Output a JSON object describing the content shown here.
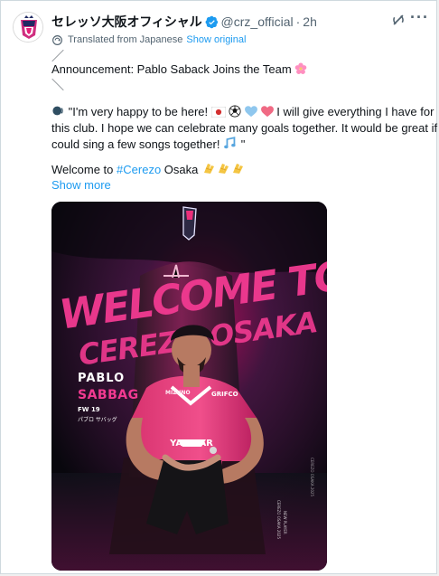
{
  "tweet": {
    "display_name": "セレッソ大阪オフィシャル",
    "handle": "@crz_official",
    "separator": "·",
    "time": "2h",
    "translated_text": "Translated from Japanese",
    "show_original": "Show original",
    "slash_top": "／",
    "announcement": "Announcement: Pablo Saback Joins the Team",
    "slash_bottom": "＼",
    "quote_line_1": "\"I'm very happy to be here!",
    "quote_line_1b": "I will give everything I have for",
    "quote_line_2": "this club. I hope we can celebrate many goals together. It would be great if we",
    "quote_line_3": "could sing a few songs together!",
    "quote_close": "\"",
    "welcome_prefix": "Welcome to",
    "hashtag": "#Cerezo",
    "welcome_suffix": "Osaka",
    "show_more": "Show more"
  },
  "icons": {
    "verified": "verified-badge-icon",
    "translate": "translate-icon",
    "grok": "grok-icon",
    "more": "more-options-icon",
    "flower": "cherry-blossom-emoji",
    "speaking": "speaking-head-emoji",
    "japan": "japan-flag-emoji",
    "soccer": "soccer-ball-emoji",
    "blue_heart": "blue-heart-emoji",
    "pink_heart": "pink-heart-emoji",
    "music": "music-notes-emoji",
    "clap": "clapping-hands-emoji"
  },
  "poster": {
    "headline_1": "WELCOME TO",
    "headline_2": "CEREZO OSAKA",
    "player_first": "PABLO",
    "player_last": "SABBAG",
    "position": "FW 19",
    "japanese_name": "パブロ サバッグ",
    "jersey_sponsor": "YANMAR",
    "jersey_brand": "GRIFCO",
    "chest_brand": "MIZUNO",
    "vertical_credit_1": "CEREZO OSAKA 2025",
    "vertical_credit_2": "NEW PLAYER"
  },
  "colors": {
    "text": "#0f1419",
    "muted": "#536471",
    "link": "#1d9bf0",
    "border": "#cfd9de",
    "background": "#ffffff",
    "brand_pink": "#e51e79",
    "poster_dark": "#090810"
  }
}
